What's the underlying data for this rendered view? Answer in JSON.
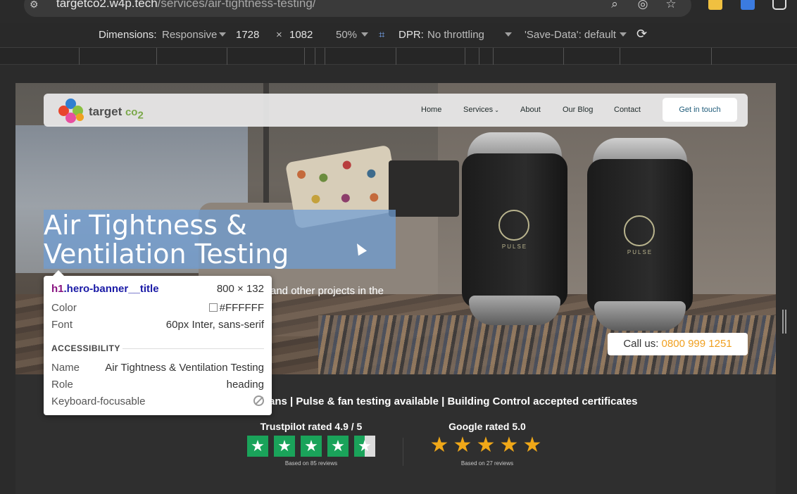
{
  "browser": {
    "url_host": "targetco2.w4p.tech",
    "url_path": "/services/air-tightness-testing/"
  },
  "device_toolbar": {
    "dimensions_label": "Dimensions:",
    "dimensions_mode": "Responsive",
    "width": "1728",
    "times": "×",
    "height": "1082",
    "zoom": "50%",
    "dpr_label": "DPR:",
    "throttling": "No throttling",
    "save_data": "'Save-Data': default"
  },
  "site": {
    "brand": "target",
    "brand_suffix": "co",
    "brand_sub": "2",
    "nav": [
      "Home",
      "Services",
      "About",
      "Our Blog",
      "Contact"
    ],
    "cta": "Get in touch",
    "hero_title": "Air Tightness & Ventilation Testing",
    "hero_subtitle_visible": "and other projects in the",
    "call_label": "Call us:",
    "call_number": "0800 999 1251",
    "fan_logo_text": "PULSE",
    "tagline": "ans | Pulse & fan testing available | Building Control accepted certificates",
    "trustpilot_title": "Trustpilot rated 4.9 / 5",
    "trustpilot_reviews": "Based on 85 reviews",
    "trustpilot_stars": 4.5,
    "google_title": "Google rated 5.0",
    "google_reviews": "Based on 27 reviews",
    "google_stars": 5
  },
  "inspect_tooltip": {
    "tag": "h1",
    "class": ".hero-banner__title",
    "size": "800 × 132",
    "color_label": "Color",
    "color_value": "#FFFFFF",
    "font_label": "Font",
    "font_value": "60px Inter, sans-serif",
    "accessibility_heading": "ACCESSIBILITY",
    "name_label": "Name",
    "name_value": "Air Tightness & Ventilation Testing",
    "role_label": "Role",
    "role_value": "heading",
    "focusable_label": "Keyboard-focusable"
  },
  "colors": {
    "accent_orange": "#f0a020",
    "trustpilot_green": "#1aa35a",
    "google_star": "#f0a818",
    "selection_highlight": "#6f9ed6"
  },
  "icons": [
    "site-info-icon",
    "zoom-icon",
    "eye-off-icon",
    "star-bookmark-icon",
    "extension-icon",
    "device-fold-icon",
    "rotate-icon",
    "cursor-icon"
  ]
}
